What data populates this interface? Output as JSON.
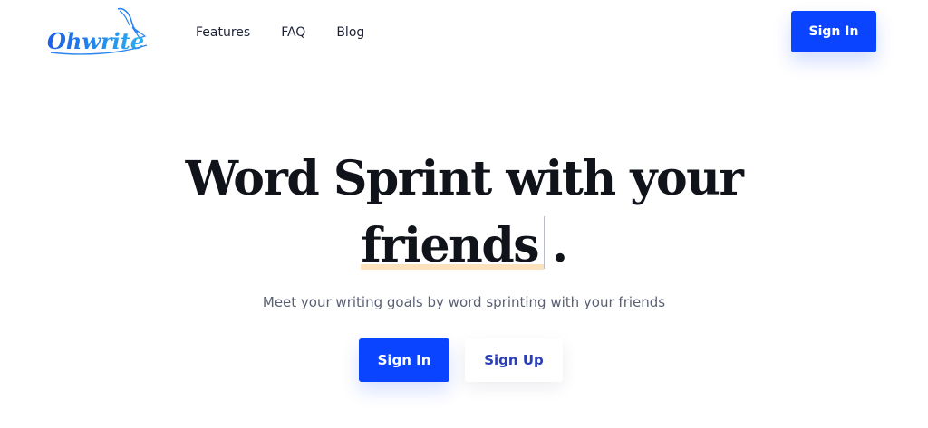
{
  "header": {
    "logo_text": "Ohwrite",
    "nav": [
      {
        "label": "Features"
      },
      {
        "label": "FAQ"
      },
      {
        "label": "Blog"
      }
    ],
    "signin_label": "Sign In"
  },
  "hero": {
    "title_line1": "Word Sprint with your",
    "typed_word": "friends",
    "title_end": ".",
    "subtitle": "Meet your writing goals by word sprinting with your friends",
    "signin_label": "Sign In",
    "signup_label": "Sign Up"
  },
  "colors": {
    "primary": "#0b44ff",
    "heading": "#11131a",
    "highlight": "#fbe2bd",
    "logo": "#1e6fe0"
  }
}
